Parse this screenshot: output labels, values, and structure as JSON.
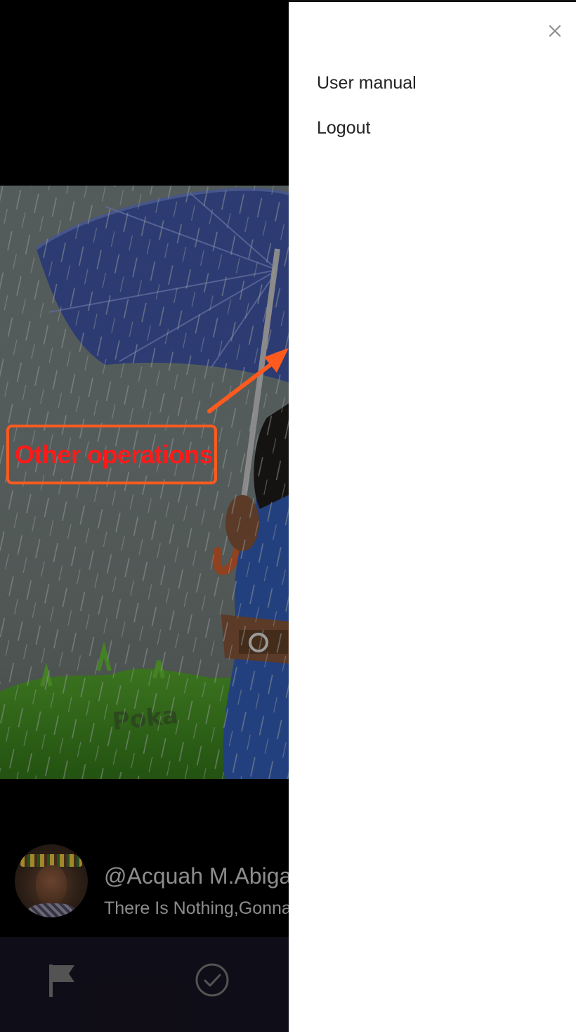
{
  "drawer": {
    "menu": [
      {
        "label": "User manual"
      },
      {
        "label": "Logout"
      }
    ],
    "close_icon": "close-icon"
  },
  "annotation": {
    "label": "Other operations",
    "color": "#ff1a1a",
    "border_color": "#ff5a1e"
  },
  "post": {
    "username": "@Acquah M.Abigail",
    "caption": "There Is Nothing,Gonna Change My Love For You",
    "watermark": "Poka"
  },
  "bottom_nav": {
    "items": [
      {
        "icon": "flag-icon"
      },
      {
        "icon": "check-circle-icon"
      }
    ]
  }
}
